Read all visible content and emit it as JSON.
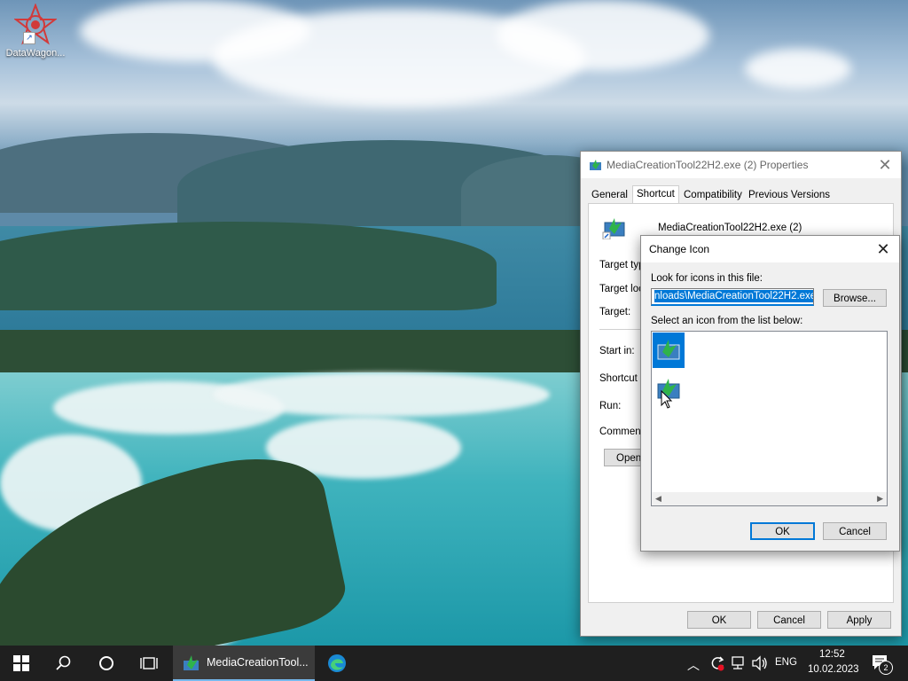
{
  "desktop": {
    "icon_label": "DataWagon..."
  },
  "properties_dialog": {
    "title": "MediaCreationTool22H2.exe (2) Properties",
    "tabs": [
      "General",
      "Shortcut",
      "Compatibility",
      "Previous Versions"
    ],
    "active_tab": "Shortcut",
    "file_name": "MediaCreationTool22H2.exe (2)",
    "fields": {
      "target_type": "Target typ",
      "target_location": "Target loc",
      "target": "Target:",
      "start_in": "Start in:",
      "shortcut_key": "Shortcut k",
      "run": "Run:",
      "comment": "Comment:"
    },
    "open_button": "Open",
    "ok": "OK",
    "cancel": "Cancel",
    "apply": "Apply"
  },
  "change_icon_dialog": {
    "title": "Change Icon",
    "look_label": "Look for icons in this file:",
    "path_value": "nloads\\MediaCreationTool22H2.exe",
    "browse": "Browse...",
    "select_label": "Select an icon from the list below:",
    "ok": "OK",
    "cancel": "Cancel"
  },
  "taskbar": {
    "active_app_label": "MediaCreationTool...",
    "language": "ENG",
    "time": "12:52",
    "date": "10.02.2023",
    "notification_count": "2"
  },
  "colors": {
    "accent": "#0078d7",
    "taskbar": "#1f1f1f"
  }
}
